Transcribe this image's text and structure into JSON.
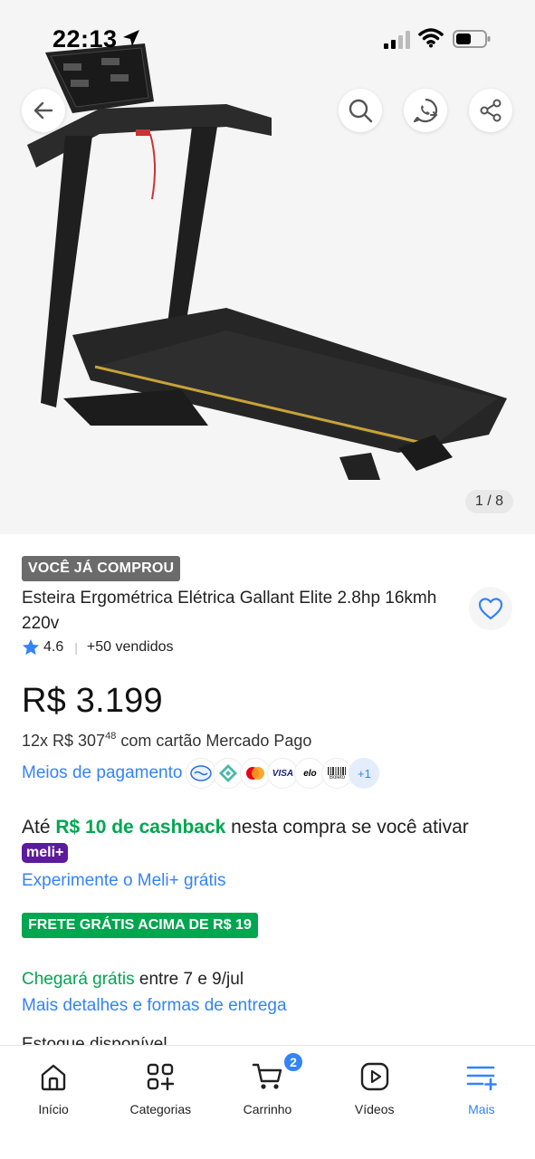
{
  "status_bar": {
    "time": "22:13",
    "icons": [
      "location-arrow-icon",
      "signal-icon",
      "wifi-icon",
      "battery-icon"
    ]
  },
  "header": {
    "buttons": [
      "back-arrow-icon",
      "search-icon",
      "whatsapp-icon",
      "share-icon"
    ]
  },
  "gallery": {
    "counter": "1 / 8",
    "image_subject": "treadmill"
  },
  "product": {
    "badge": "VOCÊ JÁ COMPROU",
    "title": "Esteira Ergométrica Elétrica Gallant Elite 2.8hp 16kmh 220v",
    "rating": "4.6",
    "sold": "+50 vendidos",
    "price": "R$ 3.199",
    "installments_prefix": "12x R$ 307",
    "installments_cents": "48",
    "installments_suffix": " com cartão Mercado Pago",
    "payment_link": "Meios de pagamento",
    "payment_more": "+1",
    "payment_methods": [
      "mercado-pago-icon",
      "pix-icon",
      "mastercard-icon",
      "VISA",
      "elo",
      "Boleto"
    ]
  },
  "cashback": {
    "prefix": "Até ",
    "amount": "R$ 10 de cashback",
    "middle": " nesta compra se você ativar ",
    "badge": "meli+",
    "try_link": "Experimente o Meli+ grátis"
  },
  "shipping": {
    "free_badge": "FRETE GRÁTIS ACIMA DE R$ 19",
    "arrival_green": "Chegará grátis",
    "arrival_rest": " entre 7 e 9/jul",
    "details_link": "Mais detalhes e formas de entrega",
    "cut_text": "Estoque disponível"
  },
  "bottom_nav": {
    "items": [
      {
        "label": "Início",
        "icon": "home-icon"
      },
      {
        "label": "Categorias",
        "icon": "categories-icon"
      },
      {
        "label": "Carrinho",
        "icon": "cart-icon",
        "badge": "2"
      },
      {
        "label": "Vídeos",
        "icon": "video-icon"
      },
      {
        "label": "Mais",
        "icon": "menu-plus-icon",
        "active": true
      }
    ]
  },
  "colors": {
    "accent_blue": "#3483fa",
    "green": "#00a650",
    "meli_purple": "#5d1a9c",
    "badge_gray": "#6b6b6b"
  }
}
